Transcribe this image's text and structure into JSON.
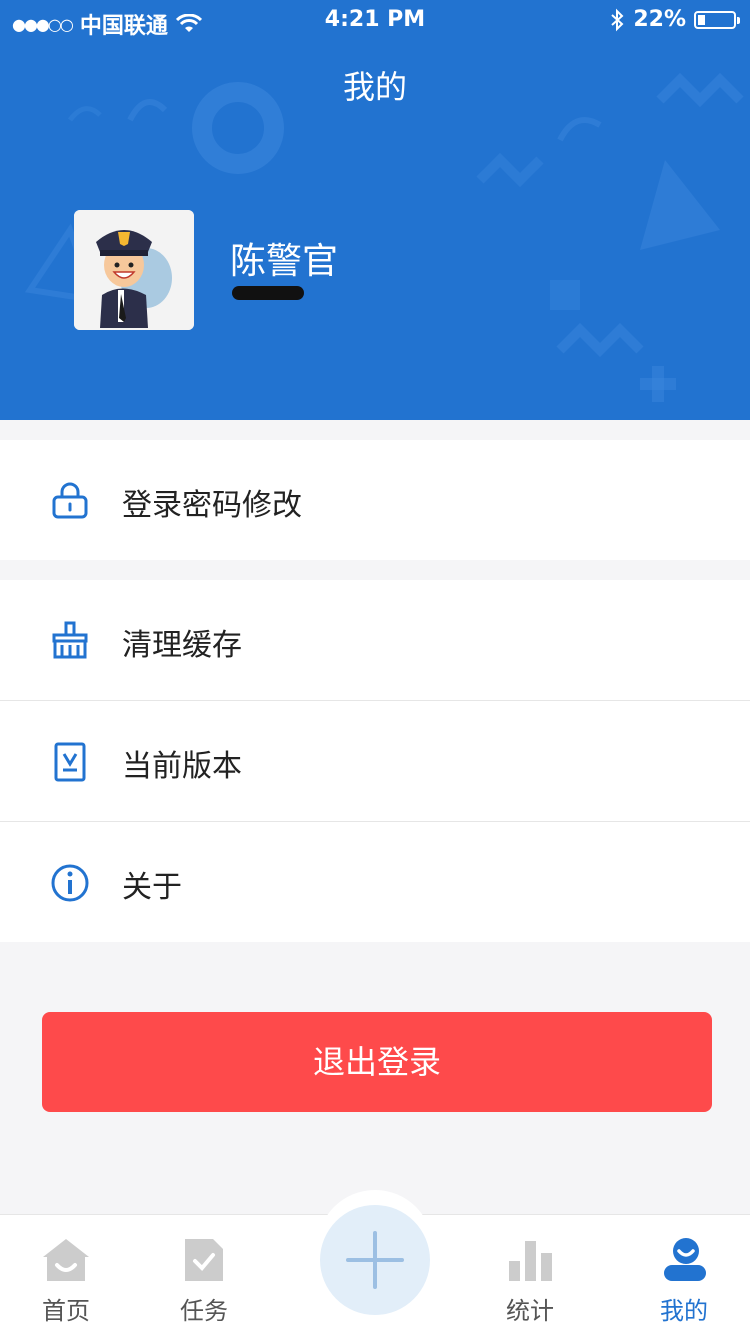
{
  "status_bar": {
    "signal": "●●●○○",
    "carrier": "中国联通",
    "time": "4:21 PM",
    "battery": "22%"
  },
  "header": {
    "title": "我的",
    "username": "陈警官"
  },
  "menu": {
    "items": [
      {
        "label": "登录密码修改",
        "icon": "lock-icon"
      },
      {
        "label": "清理缓存",
        "icon": "broom-icon"
      },
      {
        "label": "当前版本",
        "icon": "version-icon"
      },
      {
        "label": "关于",
        "icon": "info-icon"
      }
    ]
  },
  "logout_label": "退出登录",
  "tabbar": {
    "items": [
      {
        "label": "首页",
        "icon": "home-icon"
      },
      {
        "label": "任务",
        "icon": "task-icon"
      },
      {
        "label": "",
        "icon": "plus-icon"
      },
      {
        "label": "统计",
        "icon": "stats-icon"
      },
      {
        "label": "我的",
        "icon": "profile-icon"
      }
    ],
    "active": "我的"
  },
  "colors": {
    "primary": "#2273d0",
    "danger": "#fe4a4b",
    "tab_inactive": "#cccccc",
    "plus_bg": "#e2eef9"
  }
}
